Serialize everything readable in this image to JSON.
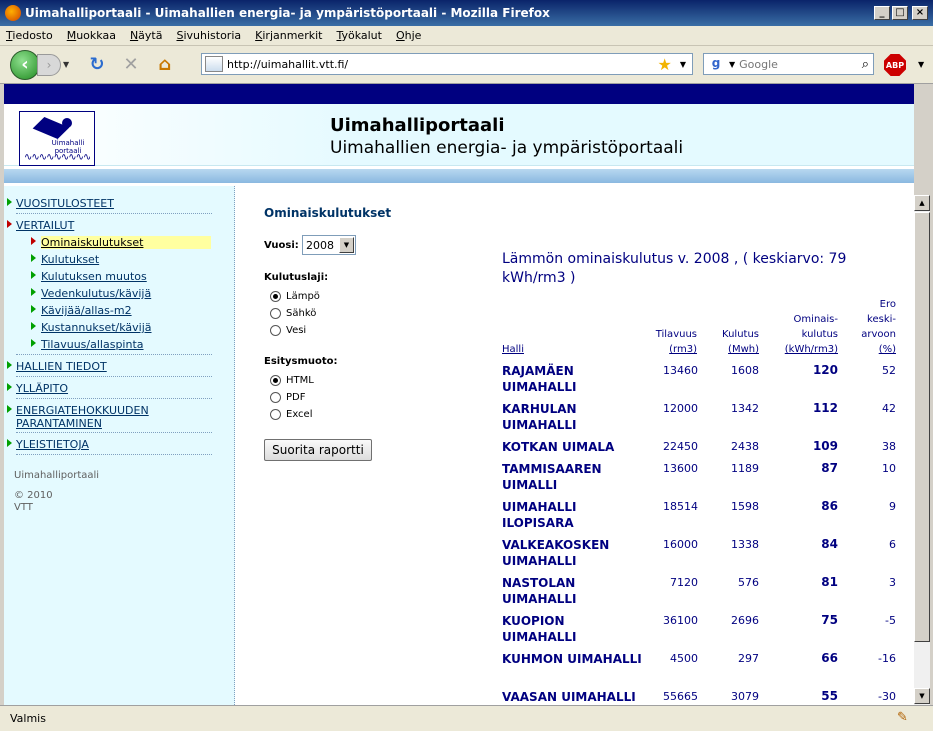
{
  "window": {
    "title": "Uimahalliportaali - Uimahallien energia- ja ympäristöportaali - Mozilla Firefox",
    "minimize": "_",
    "maximize": "□",
    "close": "×"
  },
  "menu": [
    "Tiedosto",
    "Muokkaa",
    "Näytä",
    "Sivuhistoria",
    "Kirjanmerkit",
    "Työkalut",
    "Ohje"
  ],
  "toolbar": {
    "url": "http://uimahallit.vtt.fi/",
    "search_placeholder": "Google",
    "abp_label": "ABP"
  },
  "site": {
    "logo_text": "Uimahalli portaali",
    "title": "Uimahalliportaali",
    "subtitle": "Uimahallien energia- ja ympäristöportaali"
  },
  "sidebar": {
    "items": [
      {
        "label": "VUOSITULOSTEET"
      },
      {
        "label": "VERTAILUT"
      },
      {
        "label": "HALLIEN TIEDOT"
      },
      {
        "label": "YLLÄPITO"
      },
      {
        "label": "ENERGIATEHOKKUUDEN PARANTAMINEN"
      },
      {
        "label": "YLEISTIETOJA"
      }
    ],
    "subitems": [
      {
        "label": "Ominaiskulutukset"
      },
      {
        "label": "Kulutukset"
      },
      {
        "label": "Kulutuksen muutos"
      },
      {
        "label": "Vedenkulutus/kävijä"
      },
      {
        "label": "Kävijää/allas-m2"
      },
      {
        "label": "Kustannukset/kävijä"
      },
      {
        "label": "Tilavuus/allaspinta"
      }
    ],
    "footer_name": "Uimahalliportaali",
    "footer_copyright": "© 2010",
    "footer_org": "VTT"
  },
  "form": {
    "title": "Ominaiskulutukset",
    "year_label": "Vuosi:",
    "year_value": "2008",
    "type_label": "Kulutuslaji:",
    "type_options": [
      "Lämpö",
      "Sähkö",
      "Vesi"
    ],
    "format_label": "Esitysmuoto:",
    "format_options": [
      "HTML",
      "PDF",
      "Excel"
    ],
    "submit_label": "Suorita raportti"
  },
  "report": {
    "title": "Lämmön ominaiskulutus v. 2008 , ( keskiarvo: 79 kWh/rm3 )",
    "headers": {
      "halli": "Halli",
      "tilavuus_1": "Tilavuus",
      "tilavuus_2": "(rm3)",
      "kulutus_1": "Kulutus",
      "kulutus_2": "(Mwh)",
      "omin_1": "Ominais-",
      "omin_2": "kulutus",
      "omin_3": "(kWh/rm3)",
      "ero_1": "Ero",
      "ero_2": "keski-",
      "ero_3": "arvoon",
      "ero_4": "(%)"
    },
    "rows": [
      {
        "name": "RAJAMÄEN UIMAHALLI",
        "tilavuus": "13460",
        "kulutus": "1608",
        "omin": "120",
        "ero": "52"
      },
      {
        "name": "KARHULAN UIMAHALLI",
        "tilavuus": "12000",
        "kulutus": "1342",
        "omin": "112",
        "ero": "42"
      },
      {
        "name": "KOTKAN UIMALA",
        "tilavuus": "22450",
        "kulutus": "2438",
        "omin": "109",
        "ero": "38"
      },
      {
        "name": "TAMMISAAREN UIMALLI",
        "tilavuus": "13600",
        "kulutus": "1189",
        "omin": "87",
        "ero": "10"
      },
      {
        "name": "UIMAHALLI ILOPISARA",
        "tilavuus": "18514",
        "kulutus": "1598",
        "omin": "86",
        "ero": "9"
      },
      {
        "name": "VALKEAKOSKEN UIMAHALLI",
        "tilavuus": "16000",
        "kulutus": "1338",
        "omin": "84",
        "ero": "6"
      },
      {
        "name": "NASTOLAN UIMAHALLI",
        "tilavuus": "7120",
        "kulutus": "576",
        "omin": "81",
        "ero": "3"
      },
      {
        "name": "KUOPION UIMAHALLI",
        "tilavuus": "36100",
        "kulutus": "2696",
        "omin": "75",
        "ero": "-5"
      },
      {
        "name": "KUHMON UIMAHALLI",
        "tilavuus": "4500",
        "kulutus": "297",
        "omin": "66",
        "ero": "-16"
      },
      {
        "name": "VAASAN UIMAHALLI",
        "tilavuus": "55665",
        "kulutus": "3079",
        "omin": "55",
        "ero": "-30"
      }
    ]
  },
  "status": {
    "text": "Valmis"
  }
}
